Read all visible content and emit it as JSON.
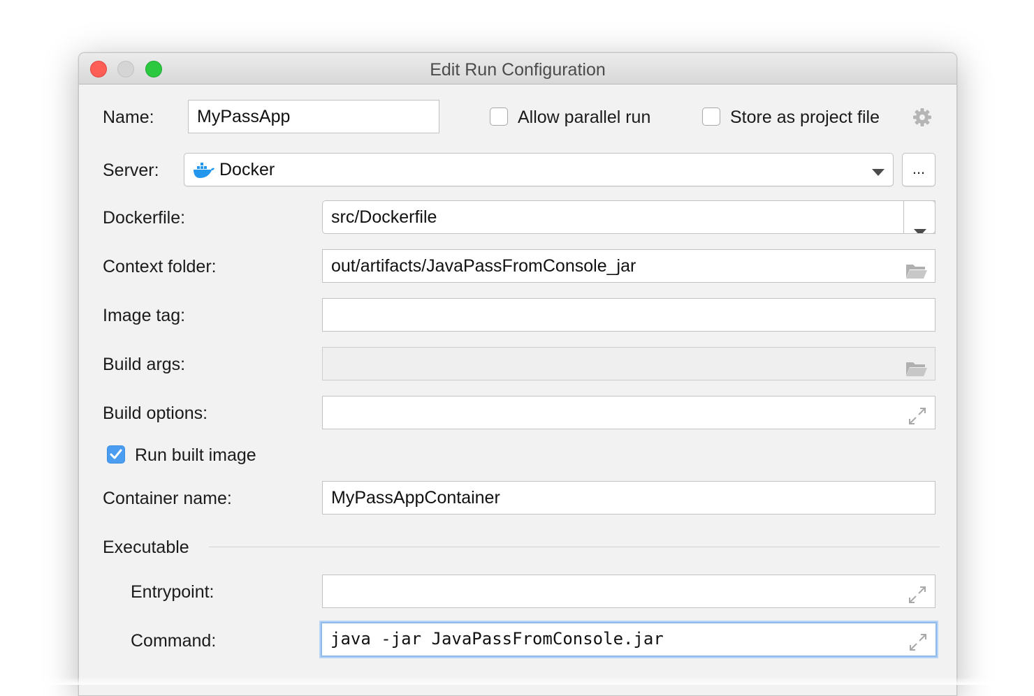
{
  "window": {
    "title": "Edit Run Configuration"
  },
  "form": {
    "name_label": "Name:",
    "name_value": "MyPassApp",
    "allow_parallel_label": "Allow parallel run",
    "allow_parallel_checked": false,
    "store_project_label": "Store as project file",
    "store_project_checked": false,
    "server_label": "Server:",
    "server_value": "Docker",
    "server_more_label": "...",
    "dockerfile_label": "Dockerfile:",
    "dockerfile_value": "src/Dockerfile",
    "context_label": "Context folder:",
    "context_value": "out/artifacts/JavaPassFromConsole_jar",
    "image_tag_label": "Image tag:",
    "image_tag_value": "",
    "build_args_label": "Build args:",
    "build_args_value": "",
    "build_options_label": "Build options:",
    "build_options_value": "",
    "run_built_label": "Run built image",
    "run_built_checked": true,
    "container_label": "Container name:",
    "container_value": "MyPassAppContainer",
    "executable_section": "Executable",
    "entrypoint_label": "Entrypoint:",
    "entrypoint_value": "",
    "command_label": "Command:",
    "command_value": "java -jar JavaPassFromConsole.jar"
  },
  "colors": {
    "accent": "#4a9df0",
    "focus_ring": "#8fb8ec",
    "close": "#fd5f57",
    "maximize": "#2cc840",
    "docker_blue": "#2396ed"
  }
}
